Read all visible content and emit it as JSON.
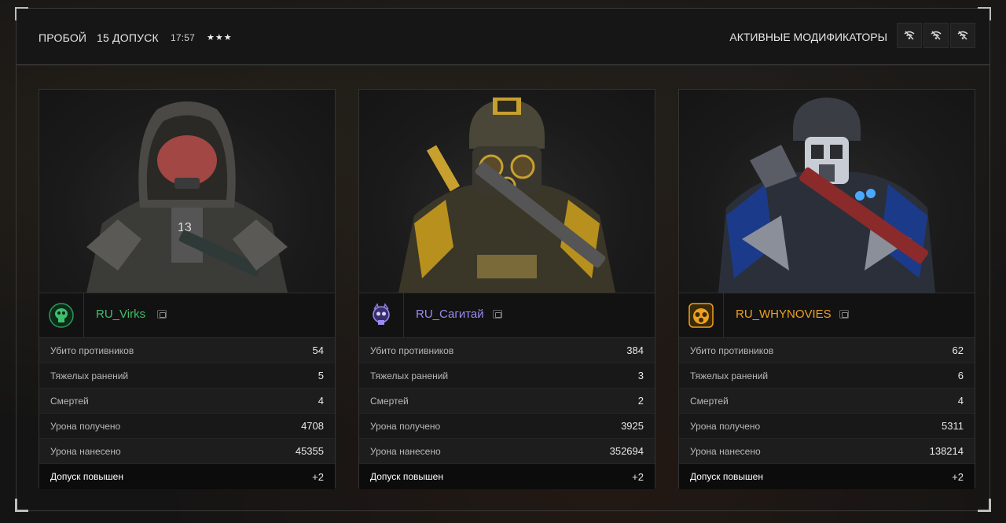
{
  "header": {
    "mode": "ПРОБОЙ",
    "level": "15 ДОПУСК",
    "time": "17:57",
    "stars": "★★★",
    "modifiers_label": "АКТИВНЫЕ МОДИФИКАТОРЫ",
    "modifier_icons": [
      "signal-off-icon",
      "signal-off-icon",
      "signal-off-icon"
    ]
  },
  "stat_labels": {
    "kills": "Убито противников",
    "heavy_wounds": "Тяжелых ранений",
    "deaths": "Смертей",
    "damage_taken": "Урона получено",
    "damage_dealt": "Урона нанесено",
    "promotion": "Допуск повышен"
  },
  "players": [
    {
      "name": "RU_Virks",
      "name_color": "#3fbf6a",
      "emblem": "green-skull-emblem-icon",
      "kills": "54",
      "heavy_wounds": "5",
      "deaths": "4",
      "damage_taken": "4708",
      "damage_dealt": "45355",
      "promotion": "+2"
    },
    {
      "name": "RU_Сагитай",
      "name_color": "#9a8cf0",
      "emblem": "purple-skull-emblem-icon",
      "kills": "384",
      "heavy_wounds": "3",
      "deaths": "2",
      "damage_taken": "3925",
      "damage_dealt": "352694",
      "promotion": "+2"
    },
    {
      "name": "RU_WHYNOVIES",
      "name_color": "#f0a020",
      "emblem": "gold-gasmask-emblem-icon",
      "kills": "62",
      "heavy_wounds": "6",
      "deaths": "4",
      "damage_taken": "5311",
      "damage_dealt": "138214",
      "promotion": "+2"
    }
  ]
}
